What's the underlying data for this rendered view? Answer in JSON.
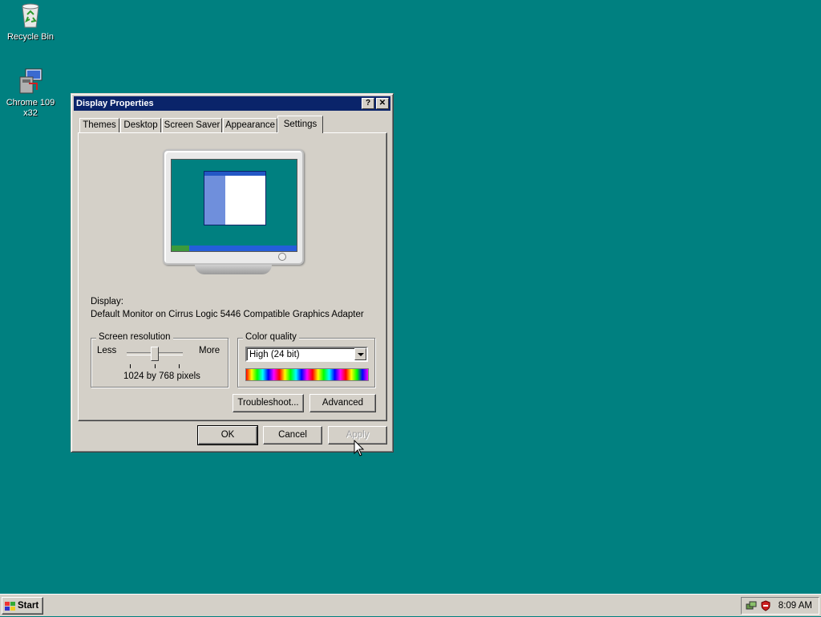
{
  "desktop": {
    "icons": [
      {
        "label": "Recycle Bin",
        "icon": "recycle-bin-icon"
      },
      {
        "label": "Chrome 109\nx32",
        "label_line1": "Chrome 109",
        "label_line2": "x32",
        "icon": "chrome-installer-icon"
      }
    ],
    "background_color": "#008080"
  },
  "window": {
    "title": "Display Properties",
    "title_buttons": {
      "help": "?",
      "close": "✕"
    },
    "tabs": [
      {
        "label": "Themes",
        "active": false
      },
      {
        "label": "Desktop",
        "active": false
      },
      {
        "label": "Screen Saver",
        "active": false
      },
      {
        "label": "Appearance",
        "active": false
      },
      {
        "label": "Settings",
        "active": true
      }
    ],
    "settings": {
      "display_label": "Display:",
      "display_value": "Default Monitor on Cirrus Logic 5446 Compatible Graphics Adapter",
      "resolution": {
        "group_title": "Screen resolution",
        "less_label": "Less",
        "more_label": "More",
        "value_text": "1024 by 768 pixels",
        "slider_position": 0.5
      },
      "color_quality": {
        "group_title": "Color quality",
        "selected": "High (24 bit)"
      },
      "troubleshoot_label": "Troubleshoot...",
      "advanced_label": "Advanced"
    },
    "buttons": {
      "ok": "OK",
      "cancel": "Cancel",
      "apply": "Apply",
      "apply_enabled": false
    }
  },
  "taskbar": {
    "start_label": "Start",
    "clock": "8:09 AM",
    "tray_icons": [
      "network-icon",
      "security-shield-icon"
    ]
  },
  "colors": {
    "title_bar": "#0a246a",
    "face": "#d4d0c8",
    "desktop": "#008080"
  }
}
